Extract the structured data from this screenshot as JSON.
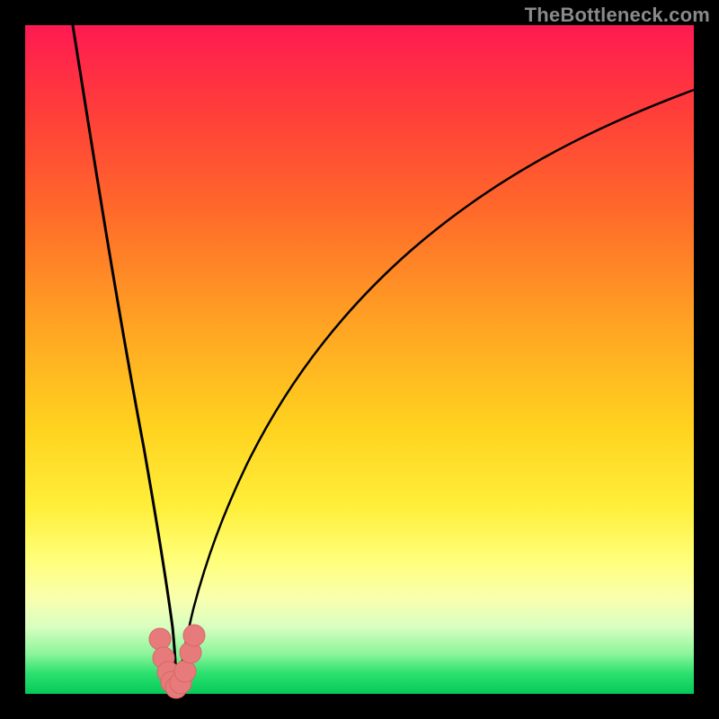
{
  "watermark": "TheBottleneck.com",
  "colors": {
    "page_bg": "#000000",
    "watermark": "#8a8a8a",
    "curve": "#000000",
    "marker": "#e77a7a",
    "gradient_top": "#ff1a52",
    "gradient_mid": "#ffd21f",
    "gradient_bottom": "#05c95a"
  },
  "chart_data": {
    "type": "line",
    "title": "",
    "xlabel": "",
    "ylabel": "",
    "xlim": [
      0,
      100
    ],
    "ylim": [
      0,
      100
    ],
    "grid": false,
    "legend": false,
    "series": [
      {
        "name": "left-branch",
        "x": [
          7,
          10,
          13,
          16,
          18,
          19.5,
          20.7,
          21.5,
          22.1,
          22.6
        ],
        "y": [
          100,
          78,
          56,
          35,
          20,
          12,
          7,
          4,
          2,
          0.5
        ]
      },
      {
        "name": "right-branch",
        "x": [
          23.0,
          23.6,
          24.5,
          26,
          28,
          31,
          35,
          40,
          46,
          54,
          63,
          73,
          84,
          96,
          100
        ],
        "y": [
          0.5,
          2,
          4.5,
          9,
          16,
          25,
          35,
          45,
          54,
          63,
          71,
          78,
          84,
          89,
          90.5
        ]
      }
    ],
    "markers": [
      {
        "x": 20.1,
        "y": 8.2,
        "r": 1.6
      },
      {
        "x": 20.7,
        "y": 5.4,
        "r": 1.6
      },
      {
        "x": 21.3,
        "y": 3.2,
        "r": 1.6
      },
      {
        "x": 21.9,
        "y": 1.8,
        "r": 1.6
      },
      {
        "x": 22.6,
        "y": 1.0,
        "r": 1.6
      },
      {
        "x": 23.3,
        "y": 1.6,
        "r": 1.6
      },
      {
        "x": 23.9,
        "y": 3.4,
        "r": 1.6
      },
      {
        "x": 24.7,
        "y": 6.2,
        "r": 1.6
      },
      {
        "x": 25.2,
        "y": 8.8,
        "r": 1.6
      }
    ],
    "note": "Axes are unlabeled in the source image; x and y are normalized 0–100 across the plotting area. The chart is a V-shaped bottleneck curve — steep on the left branch, asymptotic on the right — with salmon-colored markers clustered at the trough."
  }
}
